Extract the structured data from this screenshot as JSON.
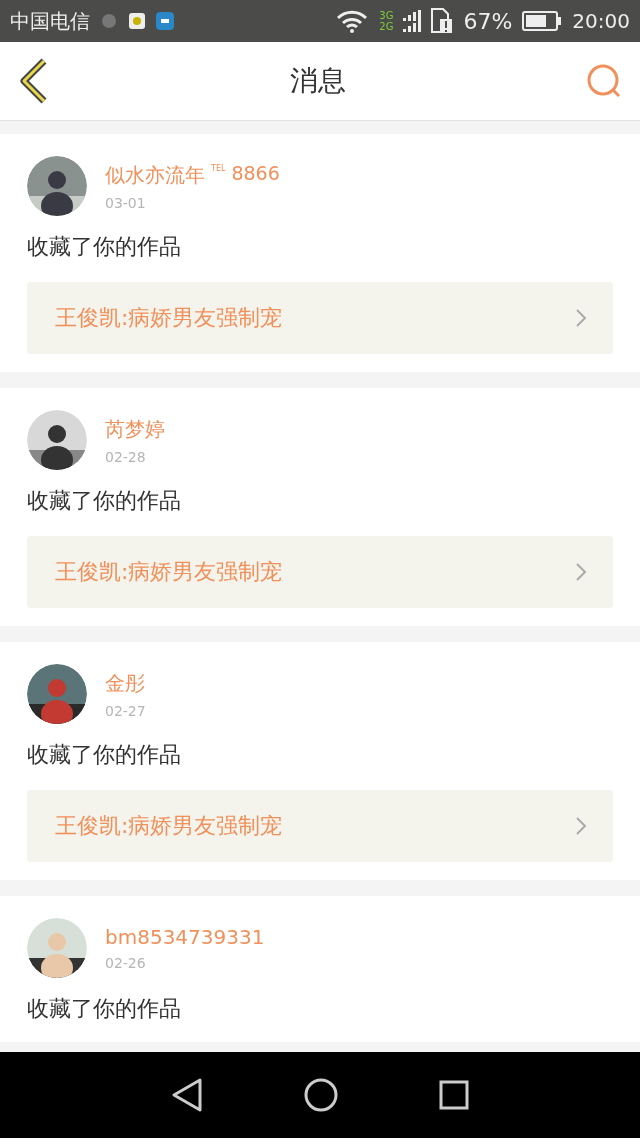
{
  "status_bar": {
    "carrier": "中国电信",
    "network_top": "3G",
    "network_bottom": "2G",
    "battery": "67%",
    "time": "20:00"
  },
  "header": {
    "title": "消息"
  },
  "messages": [
    {
      "name": "似水亦流年",
      "badge": "TEL",
      "suffix": "8866",
      "date": "03-01",
      "action": "收藏了你的作品",
      "work": "王俊凯:病娇男友强制宠"
    },
    {
      "name": "芮梦婷",
      "date": "02-28",
      "action": "收藏了你的作品",
      "work": "王俊凯:病娇男友强制宠"
    },
    {
      "name": "金彤",
      "date": "02-27",
      "action": "收藏了你的作品",
      "work": "王俊凯:病娇男友强制宠"
    },
    {
      "name": "bm8534739331",
      "date": "02-26",
      "action": "收藏了你的作品"
    }
  ]
}
